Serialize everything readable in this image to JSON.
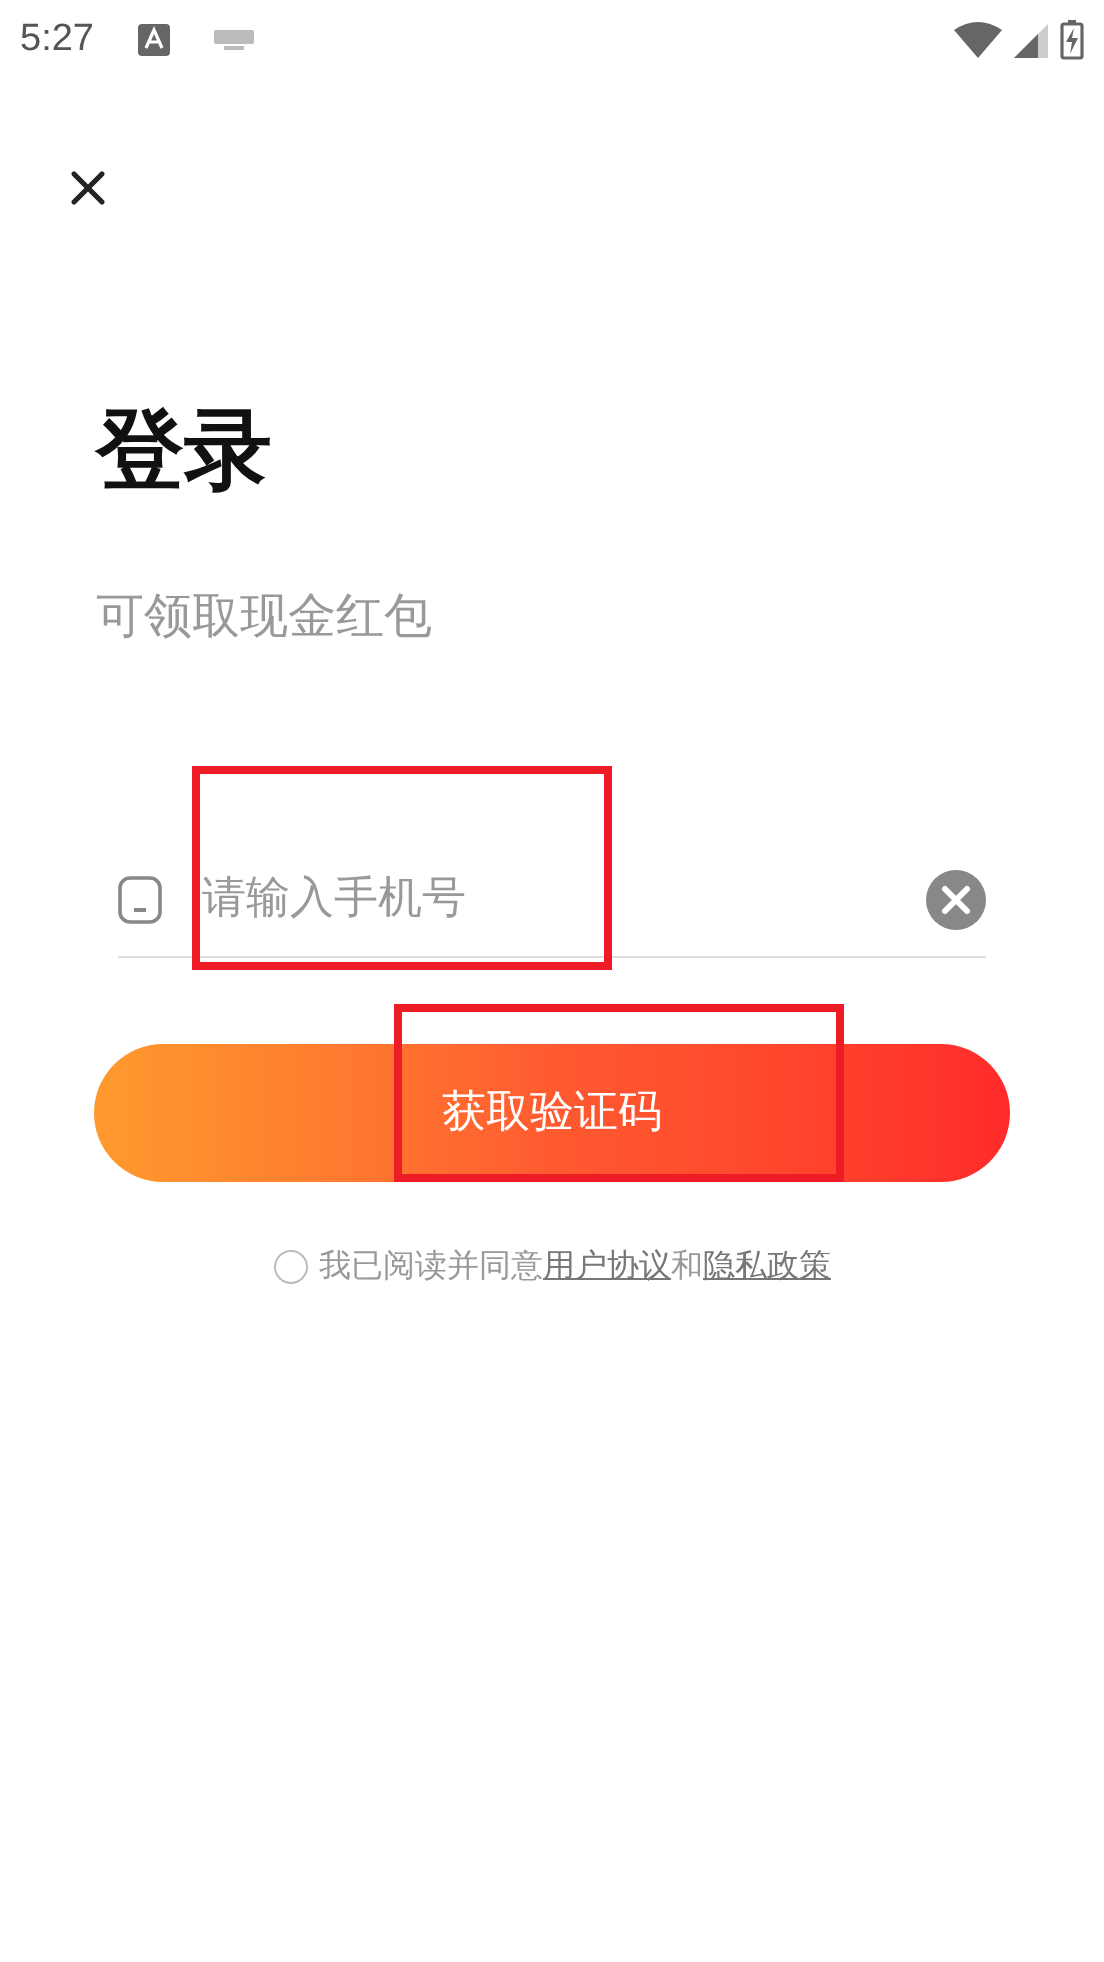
{
  "status_bar": {
    "time": "5:27"
  },
  "title": "登录",
  "subtitle": "可领取现金红包",
  "phone_field": {
    "placeholder": "请输入手机号"
  },
  "submit_button": "获取验证码",
  "agreement": {
    "agreed": false,
    "text": "我已阅读并同意",
    "link_1": "用户协议",
    "joiner": "和",
    "link_2": "隐私政策"
  },
  "annotations": [
    {
      "kind": "box"
    },
    {
      "kind": "box"
    }
  ]
}
